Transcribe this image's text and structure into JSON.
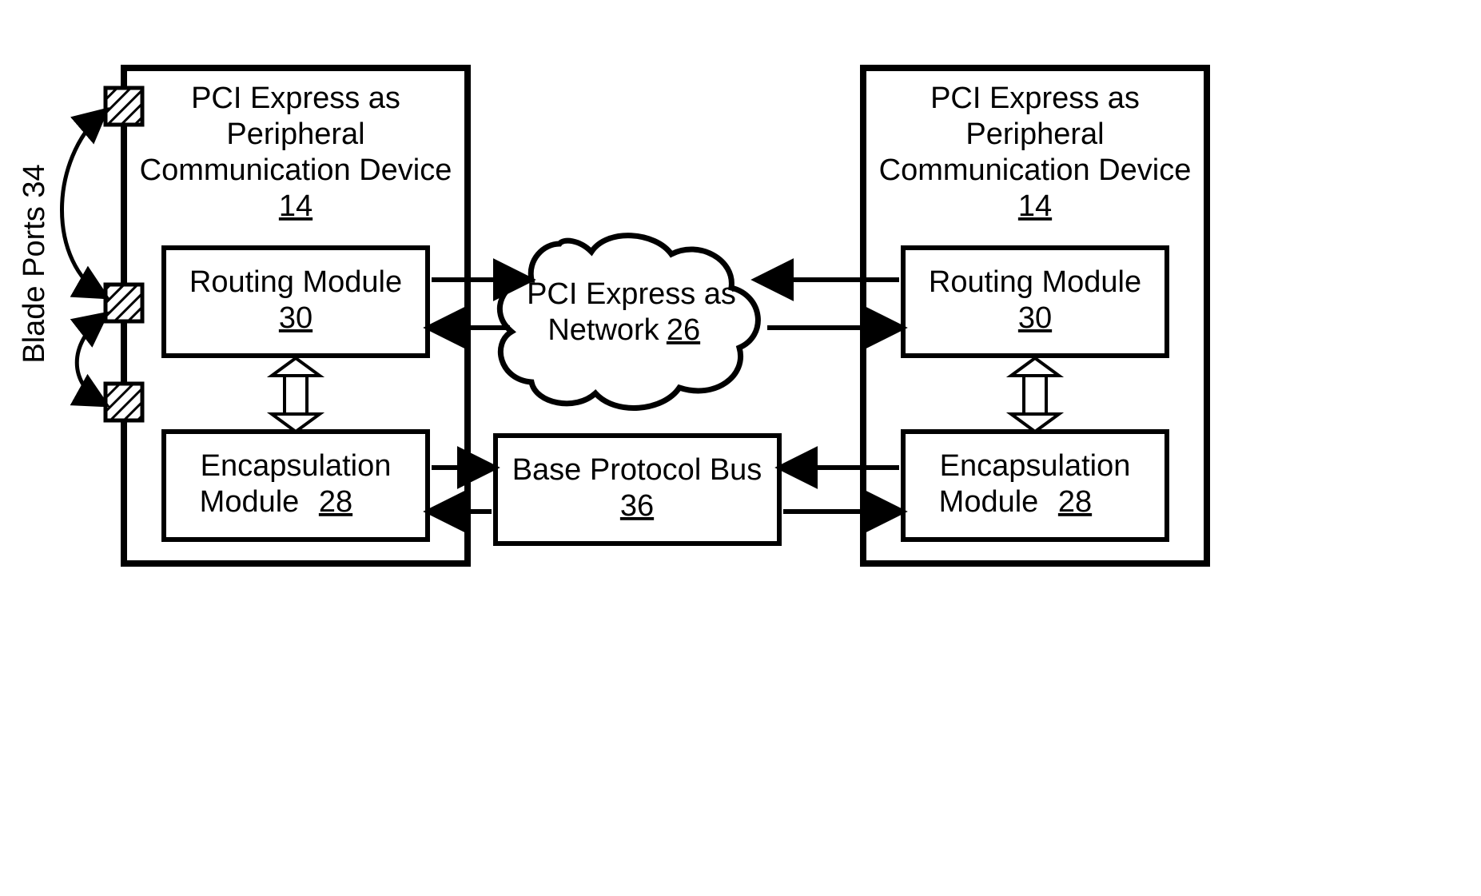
{
  "left_device": {
    "title_l1": "PCI Express as",
    "title_l2": "Peripheral",
    "title_l3": "Communication Device",
    "title_ref": "14",
    "routing_label": "Routing Module",
    "routing_ref": "30",
    "encap_l1": "Encapsulation",
    "encap_l2": "Module",
    "encap_ref": "28"
  },
  "right_device": {
    "title_l1": "PCI Express as",
    "title_l2": "Peripheral",
    "title_l3": "Communication Device",
    "title_ref": "14",
    "routing_label": "Routing Module",
    "routing_ref": "30",
    "encap_l1": "Encapsulation",
    "encap_l2": "Module",
    "encap_ref": "28"
  },
  "center": {
    "cloud_l1": "PCI Express as",
    "cloud_l2": "Network",
    "cloud_ref": "26",
    "bus_l1": "Base Protocol Bus",
    "bus_ref": "36"
  },
  "side_label": "Blade Ports 34"
}
